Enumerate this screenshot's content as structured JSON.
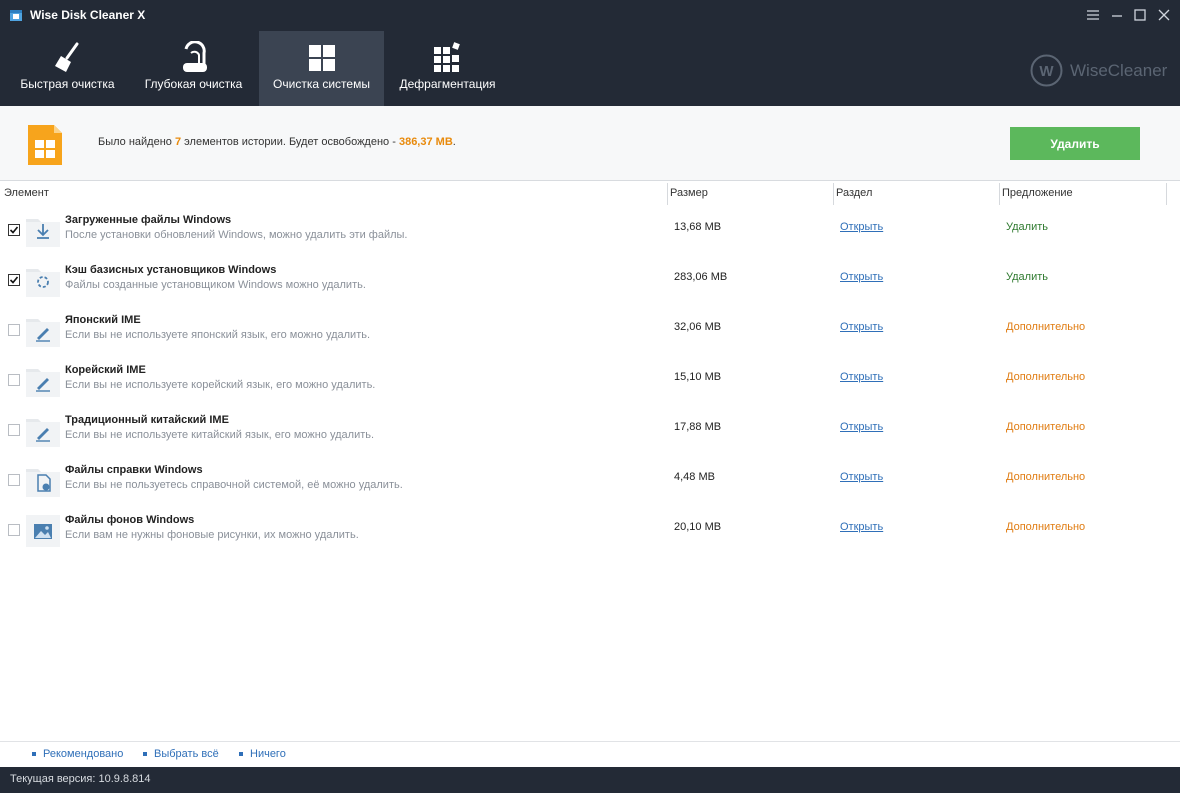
{
  "window": {
    "title": "Wise Disk Cleaner X"
  },
  "tabs": [
    {
      "label": "Быстрая очистка",
      "icon": "broom-icon",
      "active": false
    },
    {
      "label": "Глубокая очистка",
      "icon": "vacuum-icon",
      "active": false
    },
    {
      "label": "Очистка системы",
      "icon": "windows-logo-icon",
      "active": true
    },
    {
      "label": "Дефрагментация",
      "icon": "defrag-icon",
      "active": false
    }
  ],
  "brand": {
    "name": "WiseCleaner",
    "letter": "W"
  },
  "summary": {
    "prefix": "Было найдено",
    "count": "7",
    "middle": "элементов истории. Будет освобождено -",
    "size": "386,37 MB",
    "suffix": ".",
    "delete_label": "Удалить"
  },
  "columns": {
    "item": "Элемент",
    "size": "Размер",
    "section": "Раздел",
    "suggestion": "Предложение"
  },
  "rows": [
    {
      "checked": true,
      "icon": "download-icon",
      "title": "Загруженные файлы Windows",
      "desc": "После установки обновлений Windows, можно удалить эти файлы.",
      "size": "13,68 MB",
      "link": "Открыть",
      "suggestion": "Удалить",
      "suggestion_kind": "green"
    },
    {
      "checked": true,
      "icon": "installer-cache-icon",
      "title": "Кэш базисных установщиков Windows",
      "desc": "Файлы созданные установщиком Windows можно удалить.",
      "size": "283,06 MB",
      "link": "Открыть",
      "suggestion": "Удалить",
      "suggestion_kind": "green"
    },
    {
      "checked": false,
      "icon": "pen-icon",
      "title": "Японский IME",
      "desc": "Если вы не используете японский язык, его можно удалить.",
      "size": "32,06 MB",
      "link": "Открыть",
      "suggestion": "Дополнительно",
      "suggestion_kind": "orange"
    },
    {
      "checked": false,
      "icon": "pen-icon",
      "title": "Корейский IME",
      "desc": "Если вы не используете корейский язык, его можно удалить.",
      "size": "15,10 MB",
      "link": "Открыть",
      "suggestion": "Дополнительно",
      "suggestion_kind": "orange"
    },
    {
      "checked": false,
      "icon": "pen-icon",
      "title": "Традиционный китайский IME",
      "desc": "Если вы не используете китайский язык, его можно удалить.",
      "size": "17,88 MB",
      "link": "Открыть",
      "suggestion": "Дополнительно",
      "suggestion_kind": "orange"
    },
    {
      "checked": false,
      "icon": "help-file-icon",
      "title": "Файлы справки Windows",
      "desc": "Если вы не пользуетесь справочной системой, её можно удалить.",
      "size": "4,48 MB",
      "link": "Открыть",
      "suggestion": "Дополнительно",
      "suggestion_kind": "orange"
    },
    {
      "checked": false,
      "icon": "picture-icon",
      "title": "Файлы фонов Windows",
      "desc": "Если вам не нужны фоновые рисунки, их можно удалить.",
      "size": "20,10 MB",
      "link": "Открыть",
      "suggestion": "Дополнительно",
      "suggestion_kind": "orange"
    }
  ],
  "footer": {
    "recommended": "Рекомендовано",
    "select_all": "Выбрать всё",
    "none": "Ничего"
  },
  "status": {
    "version": "Текущая версия: 10.9.8.814"
  },
  "colors": {
    "accent_green": "#5cb85c",
    "highlight_orange": "#e88a0c",
    "header_bg": "#232a36",
    "active_tab_bg": "#3b4452"
  }
}
